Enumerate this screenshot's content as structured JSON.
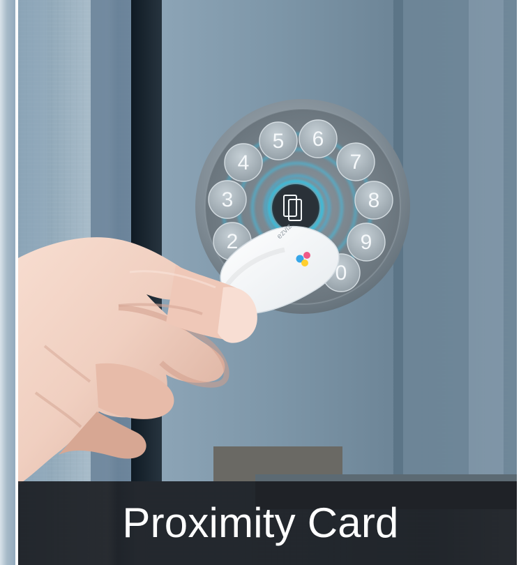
{
  "caption": {
    "text": "Proximity Card"
  },
  "keypad": {
    "keys": [
      "5",
      "6",
      "4",
      "7",
      "3",
      "8",
      "2",
      "9",
      "0"
    ],
    "center_icon": "card-icon"
  },
  "card": {
    "brand": "ezviz",
    "brand_icon": "brand-logo-icon"
  },
  "colors": {
    "background": "#7f9aac",
    "door_panel": "#879daf",
    "frame_dark": "#17242f",
    "lock_body": "#7a8790",
    "key_fill": "#9eaab3",
    "key_text": "#f6f9fb",
    "ring_glow": "#34c9f3",
    "caption_bg": "#181b1f",
    "caption_text": "#ffffff"
  }
}
